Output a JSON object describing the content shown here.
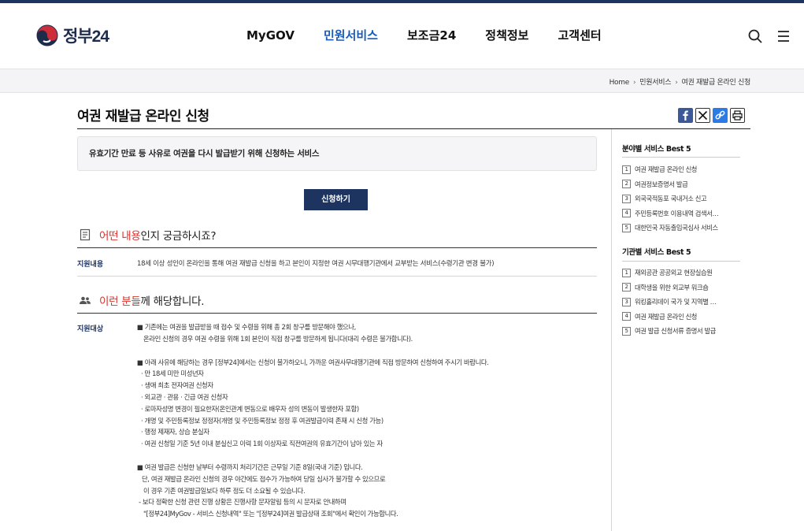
{
  "header": {
    "logo_text": "정부24",
    "nav": [
      "MyGOV",
      "민원서비스",
      "보조금24",
      "정책정보",
      "고객센터"
    ],
    "active_nav": "민원서비스",
    "search_icon": "search-icon",
    "menu_icon": "hamburger-menu-icon"
  },
  "breadcrumb": [
    "Home",
    "민원서비스",
    "여권 재발급 온라인 신청"
  ],
  "page_title": "여권 재발급 온라인 신청",
  "share_icons": [
    "facebook-icon",
    "x-twitter-icon",
    "link-icon",
    "print-icon"
  ],
  "summary": "유효기간 만료 등 사유로 여권을 다시 발급받기 위해 신청하는 서비스",
  "apply_button": "신청하기",
  "section1": {
    "highlight": "어떤 내용",
    "rest": "인지 궁금하시죠?",
    "label": "지원내용",
    "value": "18세 이상 성인이 온라인을 통해 여권 재발급 신청을 하고 본인이 지정한 여권 시무대행기관에서 교부받는 서비스(수령기관 변경 불가)"
  },
  "section2": {
    "highlight": "이런 분들",
    "rest": "께 해당합니다.",
    "label": "지원대상",
    "lines": [
      "■ 기존에는 여권을 발급받을 때 접수 및 수령을 위해 총 2회 창구를 방문해야 했으나,",
      "온라인 신청의 경우 여권 수령을 위해 1회 본인이 직접 창구를 방문하게 됩니다(대리 수령은 불가합니다).",
      "",
      "■ 아래 사유에 해당하는 경우 [정부24]에서는 신청이 불가하오니, 가까운 여권사무대행기관에 직접 방문하여 신청하여 주시기 바랍니다.",
      "· 만 18세 미만 미성년자",
      "· 생애 최초 전자여권 신청자",
      "· 외교관 · 관용 · 긴급 여권 신청자",
      "· 로마자성명 변경이 필요한자(온인관계 변동으로 배우자 성의 변동이 발생한자 포함)",
      "· 개명 및 주민등록정보 정정자(개명 및 주민등록정보 정정 후 여권발급이력 존재 시 신청 가능)",
      "· 행정 제재자, 상습 분실자",
      "· 여권 신청일 기준 5년 이내 분실신고 이력 1회 이상자로 직전여권의 유효기간이 남아 있는 자",
      "",
      "■ 여권 발급은 신청한 날부터 수령까지 처리기간은 근무일 기준 8일(국내 기준) 입니다.",
      "단, 여권 재발급 온라인 신청의 경우 야간에도 접수가 가능하여 당일 심사가 불가할 수 있으므로",
      "이 경우 기존 여권발급일보다 하루 정도 더 소요될 수 있습니다.",
      "- 보다 정확한 신청 관련 진행 상황은 진행사항 문자알림 등의 시 문자로 안내하며",
      "\"[정부24]MyGov - 서비스 신청내역\" 또는 \"[정부24]여권 발급상태 조회\"에서 확인이 가능합니다."
    ]
  },
  "sidebar": {
    "best_by_field_title": "분야별 서비스 Best 5",
    "best_by_field": [
      "여권 재발급 온라인 신청",
      "여권정보증명서 발급",
      "외국국적동포 국내거소 신고",
      "주민등록번호 이용내역 검색서…",
      "대한민국 자동출입국심사 서비스"
    ],
    "best_by_org_title": "기관별 서비스 Best 5",
    "best_by_org": [
      "재외공관 공공외교 현장실습원",
      "대학생을 위한 외교부 워크숍",
      "워킹홀리데이 국가 및 지역별 …",
      "여권 재발급 온라인 신청",
      "여권 발급 신청서류 증명서 발급"
    ]
  }
}
